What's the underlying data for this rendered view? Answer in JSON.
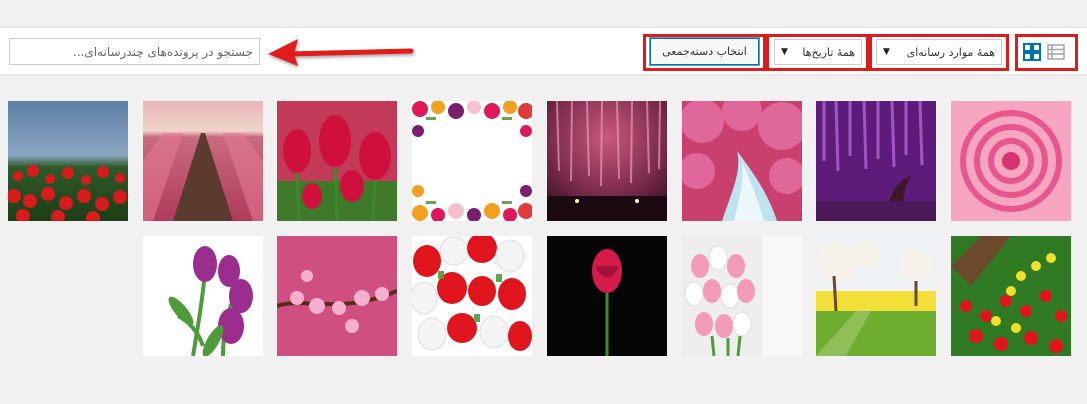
{
  "search": {
    "placeholder": "جستجو در پرونده‌های چندرسانه‌ای..."
  },
  "toolbar": {
    "bulk_select_label": "انتخاب دسته‌جمعی",
    "date_filter_value": "همهٔ تاریخ‌ها",
    "type_filter_value": "همهٔ موارد رسانه‌ای"
  },
  "colors": {
    "highlight": "#dd1c1c",
    "accent": "#0073aa",
    "icon_active": "#0073aa",
    "icon_inactive": "#a0a5aa"
  },
  "icons": {
    "grid_view": "grid-view-icon",
    "list_view": "list-view-icon",
    "arrow": "red-arrow-icon",
    "caret": "caret-down-icon"
  },
  "media": {
    "items": [
      "wildflower-field-red-tulips-lake",
      "tulip-field-rows-sunset",
      "red-tulips-closeup",
      "tulip-frame-white-center",
      "wisteria-tunnel-night",
      "pink-forest-river",
      "purple-wisteria-tree",
      "pink-dahlia-closeup",
      "purple-tulips-bouquet",
      "pink-blossom-branch",
      "red-white-tulips-frame",
      "single-red-tulip-black",
      "pink-white-tulips-white-wall",
      "blossom-trees-rapeseed-field",
      "red-yellow-tulip-field-tree"
    ]
  }
}
